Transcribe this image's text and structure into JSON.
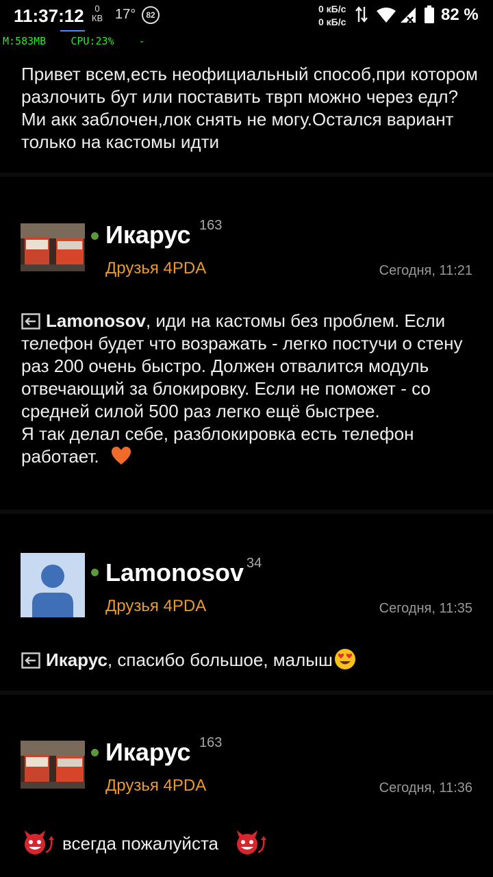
{
  "status_bar": {
    "time": "11:37:12",
    "data_top": "0",
    "data_bottom": "КВ",
    "temperature": "17°",
    "badge": "82",
    "net_up": "0 кБ/с",
    "net_down": "0 кБ/с",
    "battery": "82 %"
  },
  "monitor": {
    "text": "M:583MB    CPU:23%    -"
  },
  "top_post": {
    "text": "Привет всем,есть неофициальный способ,при котором разлочить бут или поставить тврп можно через едл?Ми акк заблочен,лок снять не могу.Остался вариант только на кастомы идти"
  },
  "posts": [
    {
      "username": "Икарус",
      "reputation": "163",
      "group": "Друзья 4PDA",
      "time": "Сегодня, 11:21",
      "reply_to": "Lamonosov",
      "text": ", иди на кастомы без проблем. Если телефон будет что возражать - легко постучи о стену раз 200 очень быстро. Должен отвалится модуль отвечающий за блокировку. Если не поможет - со средней силой 500 раз легко ещё быстрее.",
      "text2": "Я так делал себе, разблокировка есть телефон работает.",
      "emoji": "heart"
    },
    {
      "username": "Lamonosov",
      "reputation": "34",
      "group": "Друзья 4PDA",
      "time": "Сегодня, 11:35",
      "reply_to": "Икарус",
      "text": ", спасибо большое, малыш",
      "emoji": "heart-eyes"
    },
    {
      "username": "Икарус",
      "reputation": "163",
      "group": "Друзья 4PDA",
      "time": "Сегодня, 11:36",
      "text": "всегда пожалуйста",
      "emoji": "devil"
    }
  ],
  "colors": {
    "background": "#000000",
    "group": "#e89a2e",
    "online": "#5a9a3a",
    "monitor": "#2ee82e"
  }
}
